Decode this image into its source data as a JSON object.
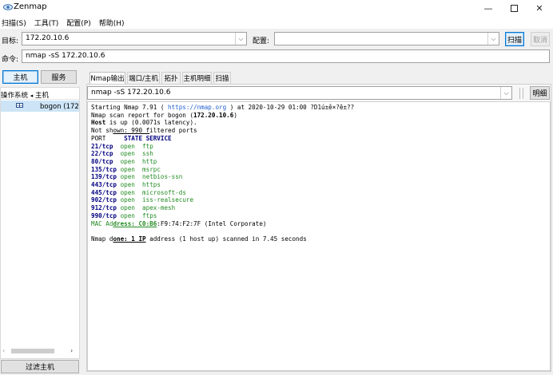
{
  "window": {
    "title": "Zenmap"
  },
  "menu": [
    {
      "label": "扫描(S)"
    },
    {
      "label": "工具(T)"
    },
    {
      "label": "配置(P)"
    },
    {
      "label": "帮助(H)"
    }
  ],
  "toolbar": {
    "target_label": "目标:",
    "target_value": "172.20.10.6",
    "profile_label": "配置:",
    "profile_value": "",
    "scan_button": "扫描",
    "cancel_button": "取消",
    "command_label": "命令:",
    "command_value": "nmap -sS 172.20.10.6"
  },
  "left": {
    "hosts_button": "主机",
    "services_button": "服务",
    "header_os": "操作系统",
    "header_host": "主机",
    "host_entry": "bogon (172",
    "filter_button": "过滤主机"
  },
  "tabs": [
    "Nmap输出",
    "端口/主机",
    "拓扑",
    "主机明细",
    "扫描"
  ],
  "output": {
    "command_select": "nmap -sS 172.20.10.6",
    "details_button": "明细",
    "lines": {
      "l1_pre": "Starting Nmap 7.91 ( ",
      "l1_link": "https://nmap.org",
      "l1_post": " ) at 2020-10-29 01:00 ?D1ú±ê×?ê±??",
      "l2_pre": "Nmap scan report for bogon (",
      "l2_bold": "172.20.10.6",
      "l2_post": ")",
      "l3_bold": "Host",
      "l3_post": " is up (0.0071s latency).",
      "l4_pre": "Not sh",
      "l4_u": "own: 990 f",
      "l4_post": "iltered ports",
      "header_port": "PORT     ",
      "header_rest": "STATE SERVICE",
      "ports": [
        {
          "port": "21/tcp",
          "pad": "  ",
          "state": "open",
          "service": "ftp"
        },
        {
          "port": "22/tcp",
          "pad": "  ",
          "state": "open",
          "service": "ssh"
        },
        {
          "port": "80/tcp",
          "pad": "  ",
          "state": "open",
          "service": "http"
        },
        {
          "port": "135/tcp",
          "pad": " ",
          "state": "open",
          "service": "msrpc"
        },
        {
          "port": "139/tcp",
          "pad": " ",
          "state": "open",
          "service": "netbios-ssn"
        },
        {
          "port": "443/tcp",
          "pad": " ",
          "state": "open",
          "service": "https"
        },
        {
          "port": "445/tcp",
          "pad": " ",
          "state": "open",
          "service": "microsoft-ds"
        },
        {
          "port": "902/tcp",
          "pad": " ",
          "state": "open",
          "service": "iss-realsecure"
        },
        {
          "port": "912/tcp",
          "pad": " ",
          "state": "open",
          "service": "apex-mesh"
        },
        {
          "port": "990/tcp",
          "pad": " ",
          "state": "open",
          "service": "ftps"
        }
      ],
      "mac_pre": "MAC Ad",
      "mac_u": "dress: C0:B6",
      "mac_post": ":F9:74:F2:7F (Intel Corporate)",
      "done_pre": "Nmap d",
      "done_u": "one: 1 IP",
      "done_post": " address (1 host up) scanned in 7.45 seconds"
    }
  }
}
